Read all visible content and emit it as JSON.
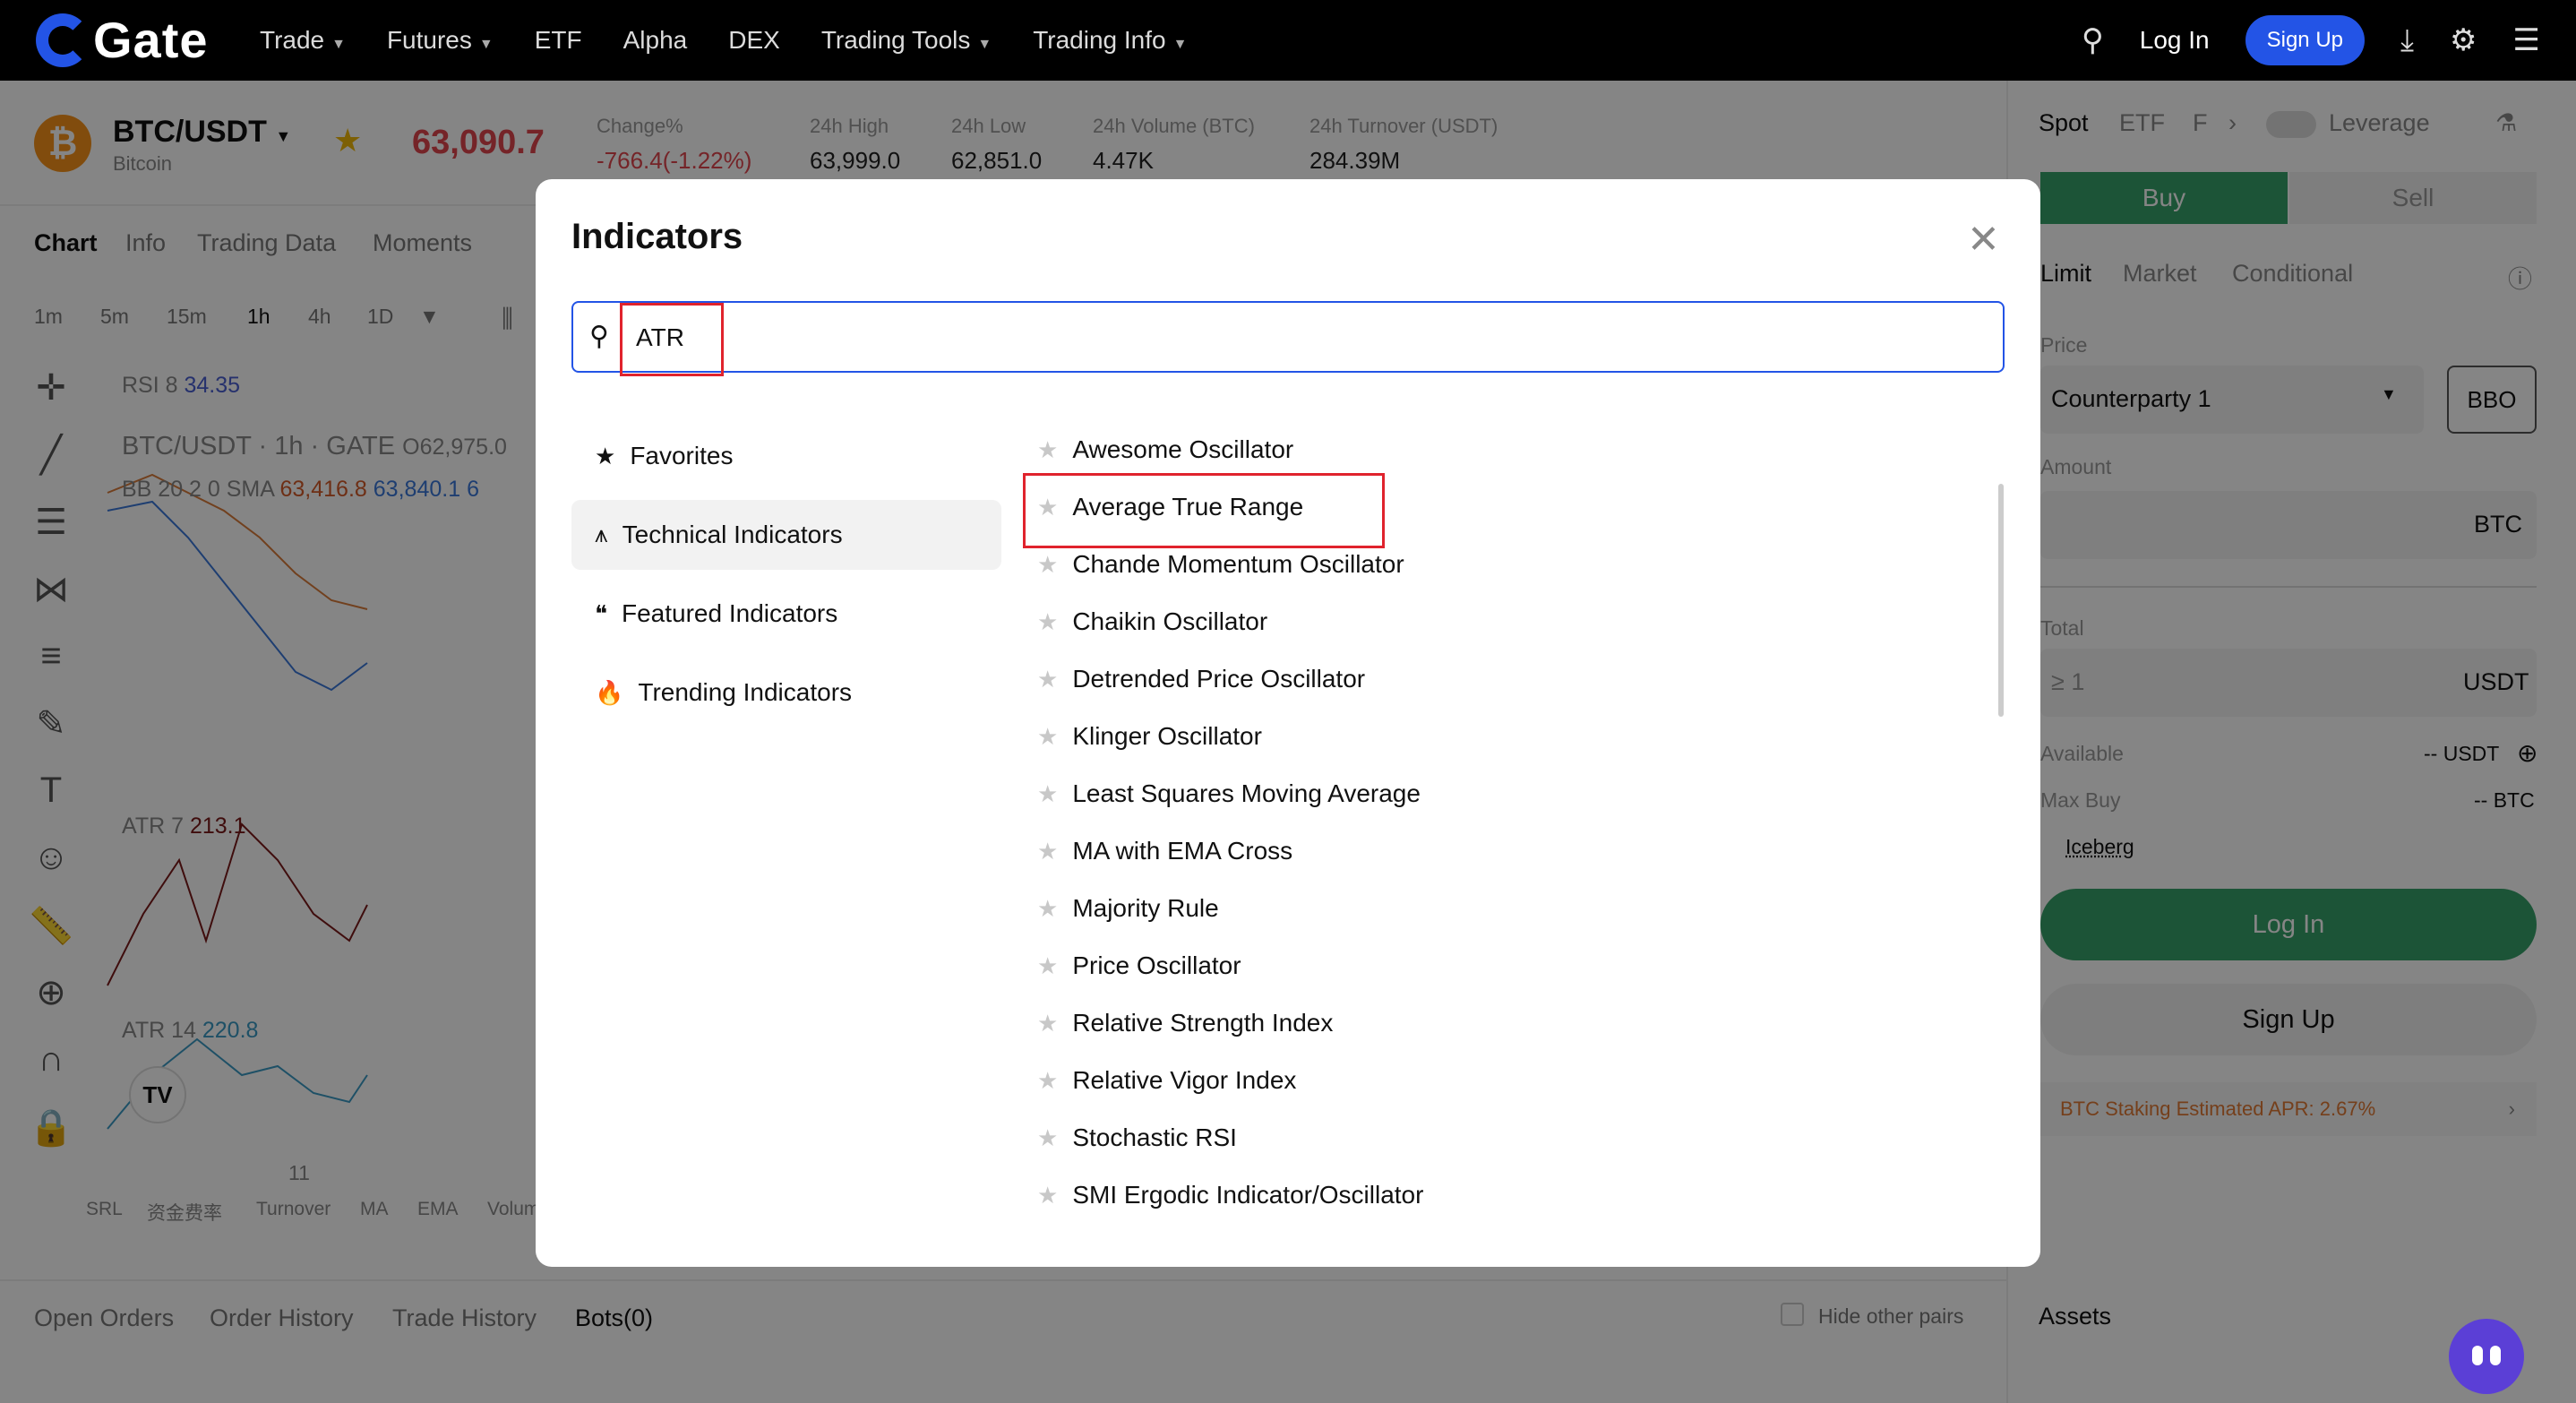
{
  "app": {
    "logo_text": "Gate"
  },
  "nav": {
    "items": [
      {
        "label": "Trade",
        "caret": true
      },
      {
        "label": "Futures",
        "caret": true
      },
      {
        "label": "ETF",
        "caret": false
      },
      {
        "label": "Alpha",
        "caret": false
      },
      {
        "label": "DEX",
        "caret": false
      },
      {
        "label": "Trading Tools",
        "caret": true
      },
      {
        "label": "Trading Info",
        "caret": true
      }
    ],
    "login": "Log In",
    "signup": "Sign Up"
  },
  "ticker": {
    "pair": "BTC/USDT",
    "coin": "Bitcoin",
    "price": "63,090.7",
    "change_label": "Change%",
    "change_value": "-766.4(-1.22%)",
    "high_label": "24h High",
    "high_value": "63,999.0",
    "low_label": "24h Low",
    "low_value": "62,851.0",
    "volume_label": "24h Volume (BTC)",
    "volume_value": "4.47K",
    "turnover_label": "24h Turnover (USDT)",
    "turnover_value": "284.39M"
  },
  "chart_tabs": [
    "Chart",
    "Info",
    "Trading Data",
    "Moments"
  ],
  "timeframes": [
    "1m",
    "5m",
    "15m",
    "1h",
    "4h",
    "1D"
  ],
  "chart_labels": {
    "rsi": "RSI 8",
    "rsi_value": "34.35",
    "title": "BTC/USDT · 1h · GATE",
    "open": "O62,975.0",
    "bb": "BB 20 2 0 SMA",
    "bb_v1": "63,416.8",
    "bb_v2": "63,840.1",
    "bb_v3": "6",
    "atr7": "ATR 7",
    "atr7_value": "213.1",
    "atr14": "ATR 14",
    "atr14_value": "220.8",
    "date_tick": "11"
  },
  "bottom_indicators": [
    "SRL",
    "资金费率",
    "Turnover",
    "MA",
    "EMA",
    "Volum"
  ],
  "bottom_tabs": [
    "Open Orders",
    "Order History",
    "Trade History",
    "Bots(0)"
  ],
  "hide_other_pairs": "Hide other pairs",
  "assets_label": "Assets",
  "right_panel": {
    "tabs": [
      "Spot",
      "ETF",
      "F"
    ],
    "leverage": "Leverage",
    "buy": "Buy",
    "sell": "Sell",
    "order_types": [
      "Limit",
      "Market",
      "Conditional"
    ],
    "price_label": "Price",
    "price_value": "Counterparty 1",
    "bbo": "BBO",
    "amount_label": "Amount",
    "amount_unit": "BTC",
    "total_label": "Total",
    "total_placeholder": "≥ 1",
    "total_unit": "USDT",
    "available_label": "Available",
    "available_value": "-- USDT",
    "maxbuy_label": "Max Buy",
    "maxbuy_value": "-- BTC",
    "iceberg": "Iceberg",
    "login": "Log In",
    "signup": "Sign Up",
    "apr": "BTC Staking Estimated APR: 2.67%"
  },
  "modal": {
    "title": "Indicators",
    "search_value": "ATR",
    "categories": [
      {
        "label": "Favorites",
        "icon": "star-icon",
        "active": false
      },
      {
        "label": "Technical Indicators",
        "icon": "chart-icon",
        "active": true
      },
      {
        "label": "Featured Indicators",
        "icon": "quote-icon",
        "active": false
      },
      {
        "label": "Trending Indicators",
        "icon": "fire-icon",
        "active": false
      }
    ],
    "results": [
      "Awesome Oscillator",
      "Average True Range",
      "Chande Momentum Oscillator",
      "Chaikin Oscillator",
      "Detrended Price Oscillator",
      "Klinger Oscillator",
      "Least Squares Moving Average",
      "MA with EMA Cross",
      "Majority Rule",
      "Price Oscillator",
      "Relative Strength Index",
      "Relative Vigor Index",
      "Stochastic RSI",
      "SMI Ergodic Indicator/Oscillator"
    ]
  },
  "colors": {
    "brand": "#2354e6",
    "up": "#37a26a",
    "down": "#e0454d",
    "highlight": "#e0232d"
  }
}
